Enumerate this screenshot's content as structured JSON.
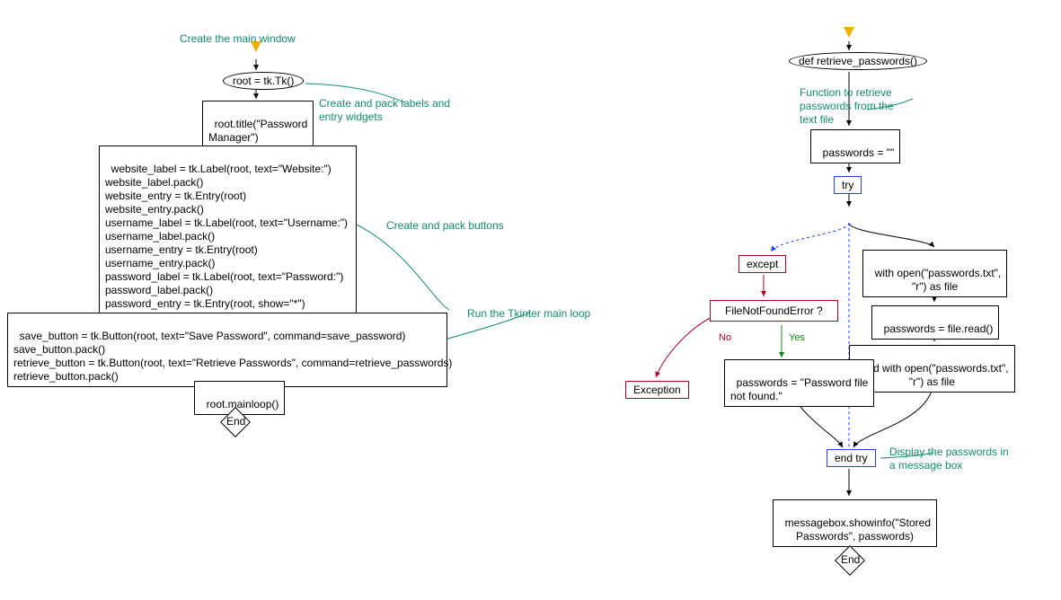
{
  "left": {
    "comments": {
      "create_window": "Create the main window",
      "create_widgets": "Create and pack labels and\nentry widgets",
      "create_buttons": "Create and pack buttons",
      "run_mainloop": "Run the Tkinter main loop"
    },
    "nodes": {
      "root_tk": "root = tk.Tk()",
      "root_title": "root.title(\"Password\nManager\")",
      "widgets": "website_label = tk.Label(root, text=\"Website:\")\nwebsite_label.pack()\nwebsite_entry = tk.Entry(root)\nwebsite_entry.pack()\nusername_label = tk.Label(root, text=\"Username:\")\nusername_label.pack()\nusername_entry = tk.Entry(root)\nusername_entry.pack()\npassword_label = tk.Label(root, text=\"Password:\")\npassword_label.pack()\npassword_entry = tk.Entry(root, show=\"*\")\npassword_entry.pack()",
      "buttons": "save_button = tk.Button(root, text=\"Save Password\", command=save_password)\nsave_button.pack()\nretrieve_button = tk.Button(root, text=\"Retrieve Passwords\", command=retrieve_passwords)\nretrieve_button.pack()",
      "mainloop": "root.mainloop()",
      "end": "End"
    }
  },
  "right": {
    "comments": {
      "func_desc": "Function to retrieve\npasswords from the\ntext file",
      "display_msg": "Display the passwords in\na message box"
    },
    "nodes": {
      "def": "def retrieve_passwords()",
      "init": "passwords = \"\"",
      "try": "try",
      "except": "except",
      "with_open": "with open(\"passwords.txt\",\n\"r\") as file",
      "read": "passwords = file.read()",
      "end_with": "end with open(\"passwords.txt\",\n\"r\") as file",
      "decision": "FileNotFoundError ?",
      "exception": "Exception",
      "not_found": "passwords = \"Password file\nnot found.\"",
      "end_try": "end try",
      "showinfo": "messagebox.showinfo(\"Stored\nPasswords\", passwords)",
      "end": "End"
    },
    "labels": {
      "no": "No",
      "yes": "Yes"
    }
  }
}
